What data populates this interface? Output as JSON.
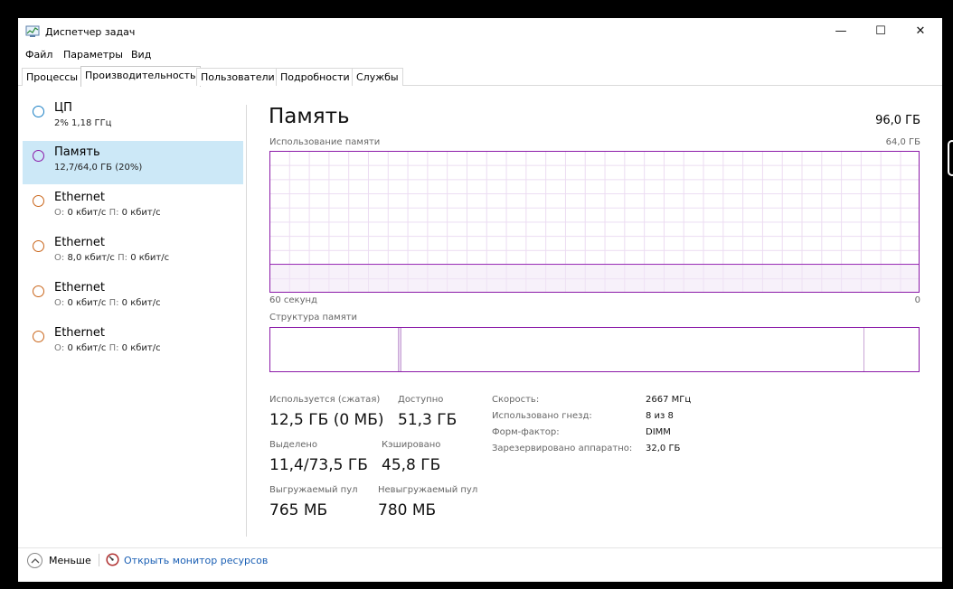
{
  "window": {
    "title": "Диспетчер задач",
    "controls": [
      "—",
      "☐",
      "✕"
    ]
  },
  "menu": [
    "Файл",
    "Параметры",
    "Вид"
  ],
  "tabs": [
    "Процессы",
    "Производительность",
    "Пользователи",
    "Подробности",
    "Службы"
  ],
  "active_tab": "Производительность",
  "sidebar": {
    "items": [
      {
        "name": "ЦП",
        "sub": "2% 1,18 ГГц",
        "color": "#1a7fc4",
        "selected": false
      },
      {
        "name": "Память",
        "sub": "12,7/64,0 ГБ (20%)",
        "color": "#8b1aa8",
        "selected": true
      },
      {
        "name": "Ethernet",
        "o": "О:",
        "o_val": "0 кбит/с",
        "p": "П:",
        "p_val": "0 кбит/с",
        "color": "#c9651a",
        "selected": false
      },
      {
        "name": "Ethernet",
        "o": "О:",
        "o_val": "8,0 кбит/с",
        "p": "П:",
        "p_val": "0 кбит/с",
        "color": "#c9651a",
        "selected": false
      },
      {
        "name": "Ethernet",
        "o": "О:",
        "o_val": "0 кбит/с",
        "p": "П:",
        "p_val": "0 кбит/с",
        "color": "#c9651a",
        "selected": false
      },
      {
        "name": "Ethernet",
        "o": "О:",
        "o_val": "0 кбит/с",
        "p": "П:",
        "p_val": "0 кбит/с",
        "color": "#c9651a",
        "selected": false
      }
    ]
  },
  "main": {
    "title": "Память",
    "total": "96,0 ГБ",
    "usage_label": "Использование памяти",
    "usage_max": "64,0 ГБ",
    "usage_fraction": 0.2,
    "time_left": "60 секунд",
    "time_right": "0",
    "composition_label": "Структура памяти",
    "stats": {
      "in_use_label": "Используется (сжатая)",
      "in_use_value": "12,5 ГБ (0 МБ)",
      "available_label": "Доступно",
      "available_value": "51,3 ГБ",
      "committed_label": "Выделено",
      "committed_value": "11,4/73,5 ГБ",
      "cached_label": "Кэшировано",
      "cached_value": "45,8 ГБ",
      "paged_label": "Выгружаемый пул",
      "paged_value": "765 МБ",
      "nonpaged_label": "Невыгружаемый пул",
      "nonpaged_value": "780 МБ"
    },
    "details": [
      {
        "label": "Скорость:",
        "value": "2667 МГц"
      },
      {
        "label": "Использовано гнезд:",
        "value": "8 из 8"
      },
      {
        "label": "Форм-фактор:",
        "value": "DIMM"
      },
      {
        "label": "Зарезервировано аппаратно:",
        "value": "32,0 ГБ"
      }
    ]
  },
  "footer": {
    "fewer_label": "Меньше",
    "monitor_link": "Открыть монитор ресурсов"
  }
}
